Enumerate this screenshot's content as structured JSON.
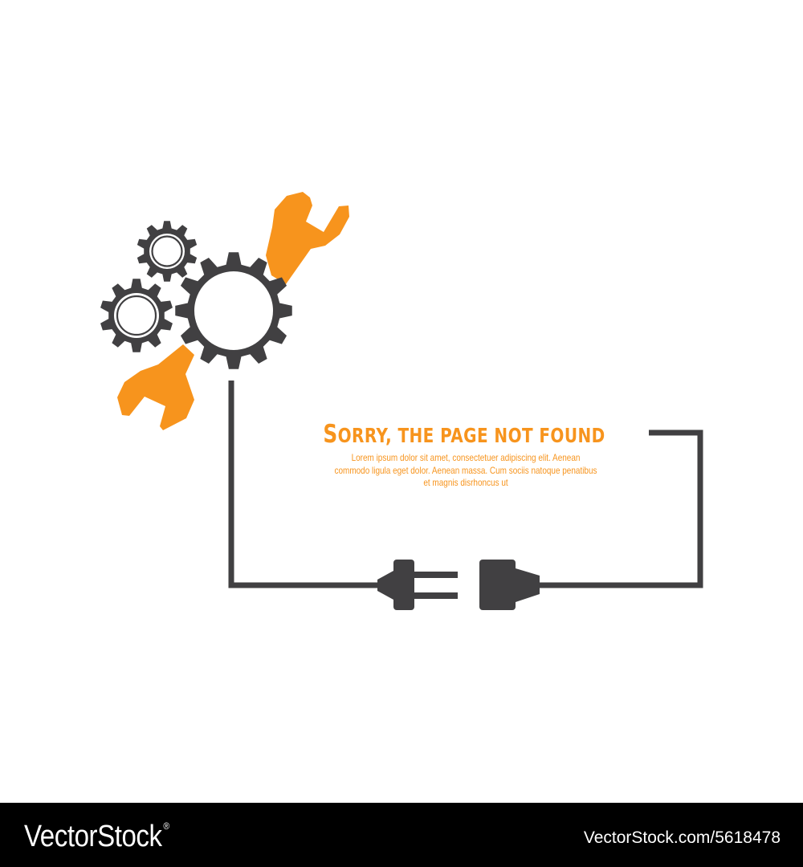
{
  "colors": {
    "accent": "#f7941d",
    "dark": "#414042",
    "background": "#ffffff",
    "footer_bar": "#000000",
    "footer_text": "#ffffff"
  },
  "icons": {
    "gear_small_top": "gear-icon",
    "gear_small_left": "gear-icon",
    "gear_large": "gear-icon",
    "wrench_top": "wrench-icon",
    "wrench_bottom": "wrench-icon",
    "plug": "plug-icon",
    "socket": "socket-icon"
  },
  "message": {
    "headline_first": "S",
    "headline_rest": "ORRY, THE PAGE NOT FOUND",
    "body_lines": [
      "Lorem ipsum dolor sit amet, consectetuer adipiscing elit. Aenean",
      "commodo ligula eget dolor. Aenean massa. Cum sociis natoque penatibus",
      "et magnis disrhoncus ut"
    ]
  },
  "footer": {
    "logo": "VectorStock",
    "registered_mark": "®",
    "image_id": "VectorStock.com/5618478"
  }
}
